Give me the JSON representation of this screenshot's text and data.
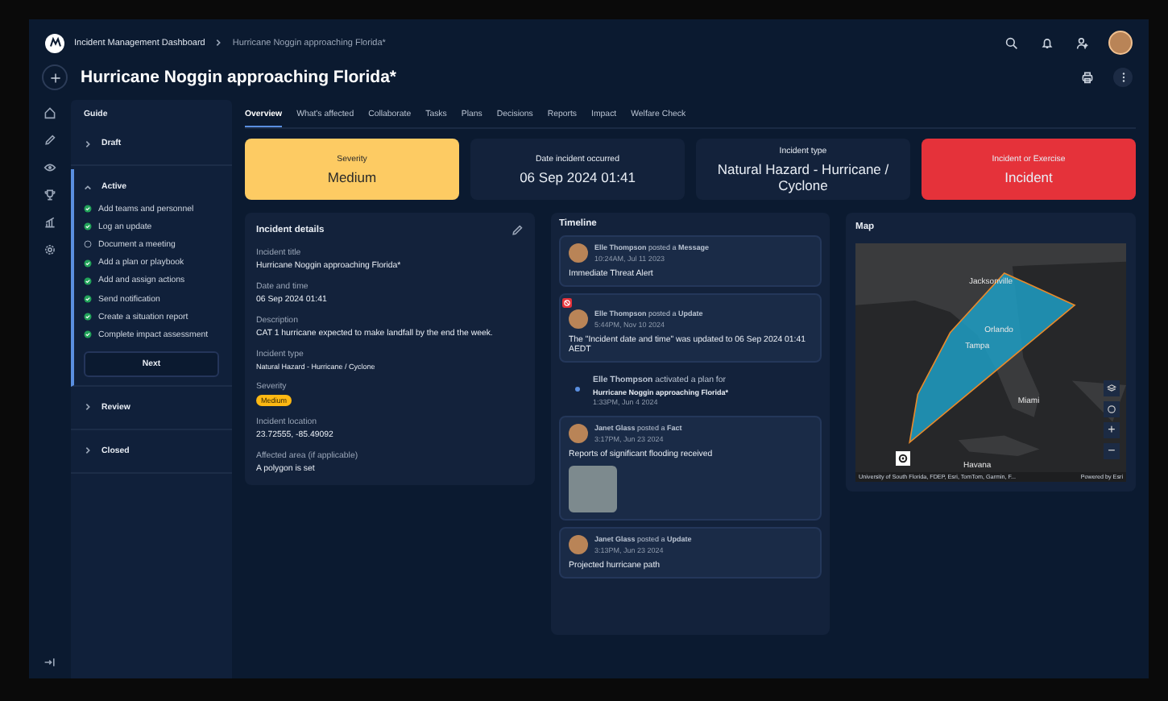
{
  "breadcrumb": [
    "Incident Management Dashboard",
    "Hurricane Noggin approaching Florida*"
  ],
  "title": "Hurricane Noggin approaching Florida*",
  "guide": {
    "title": "Guide",
    "next_button": "Next",
    "sections": [
      {
        "label": "Draft",
        "expanded": false
      },
      {
        "label": "Active",
        "expanded": true,
        "steps": [
          {
            "label": "Add teams and personnel",
            "checked": true
          },
          {
            "label": "Log an update",
            "checked": true
          },
          {
            "label": "Document a meeting",
            "checked": false
          },
          {
            "label": "Add a plan or playbook",
            "checked": true
          },
          {
            "label": "Add and assign actions",
            "checked": true
          },
          {
            "label": "Send notification",
            "checked": true
          },
          {
            "label": "Create a situation report",
            "checked": true
          },
          {
            "label": "Complete impact assessment",
            "checked": true
          }
        ]
      },
      {
        "label": "Review",
        "expanded": false
      },
      {
        "label": "Closed",
        "expanded": false
      }
    ]
  },
  "tabs": [
    {
      "label": "Overview",
      "selected": true
    },
    {
      "label": "What's affected",
      "selected": false
    },
    {
      "label": "Collaborate",
      "selected": false
    },
    {
      "label": "Tasks",
      "selected": false
    },
    {
      "label": "Plans",
      "selected": false
    },
    {
      "label": "Decisions",
      "selected": false
    },
    {
      "label": "Reports",
      "selected": false
    },
    {
      "label": "Impact",
      "selected": false
    },
    {
      "label": "Welfare Check",
      "selected": false
    }
  ],
  "summary_cards": [
    {
      "label": "Severity",
      "value": "Medium",
      "color": "#fdcb63"
    },
    {
      "label": "Date incident occurred",
      "value": "06 Sep 2024 01:41",
      "color": "#13223b"
    },
    {
      "label": "Incident type",
      "value": "Natural Hazard - Hurricane / Cyclone",
      "color": "#13223b"
    },
    {
      "label": "Incident or Exercise",
      "value": "Incident",
      "color": "#e5323a"
    }
  ],
  "incident_details": {
    "title": "Incident details",
    "fields": [
      {
        "label": "Incident title",
        "value": "Hurricane Noggin approaching Florida*",
        "kind": "text"
      },
      {
        "label": "Date and time",
        "value": "06 Sep 2024 01:41",
        "kind": "text"
      },
      {
        "label": "Description",
        "value": "CAT 1 hurricane expected to make landfall by the end the week.",
        "kind": "text"
      },
      {
        "label": "Incident type",
        "value": "Natural Hazard - Hurricane / Cyclone",
        "kind": "small"
      },
      {
        "label": "Severity",
        "value": "Medium",
        "kind": "badge"
      },
      {
        "label": "Incident location",
        "value": "23.72555, -85.49092",
        "kind": "text"
      },
      {
        "label": "Affected area (if applicable)",
        "value": "A polygon is set",
        "kind": "text"
      }
    ]
  },
  "timeline": {
    "title": "Timeline",
    "entries": [
      {
        "kind": "post",
        "heading": "**Elle Thompson** posted a **Message**",
        "time": "10:24AM, Jul 11 2023",
        "body": "Immediate Threat Alert",
        "alert": false,
        "photo": false
      },
      {
        "kind": "post",
        "heading": "**Elle Thompson** posted a **Update**",
        "time": "5:44PM, Nov 10 2024",
        "body": "The \"Incident date and time\" was updated to 06 Sep 2024 01:41 AEDT",
        "alert": true,
        "photo": false
      },
      {
        "kind": "activity",
        "heading": "**Elle Thompson** activated a plan for",
        "plan": "Hurricane Noggin approaching Florida*",
        "time": "1:33PM, Jun 4 2024"
      },
      {
        "kind": "post",
        "heading": "**Janet Glass** posted a **Fact**",
        "time": "3:17PM, Jun 23 2024",
        "body": "Reports of significant flooding received",
        "alert": false,
        "photo": true
      },
      {
        "kind": "post",
        "heading": "**Janet Glass** posted a **Update**",
        "time": "3:13PM, Jun 23 2024",
        "body": "Projected hurricane path",
        "alert": false,
        "photo": false
      }
    ]
  },
  "map": {
    "title": "Map",
    "places": [
      "Jacksonville",
      "Orlando",
      "Tampa",
      "Miami",
      "Havana"
    ],
    "attribution": "University of South Florida, FDEP, Esri, TomTom, Garmin, F...",
    "powered_by": "Powered by Esri",
    "zoom_in": "+",
    "zoom_out": "−"
  }
}
